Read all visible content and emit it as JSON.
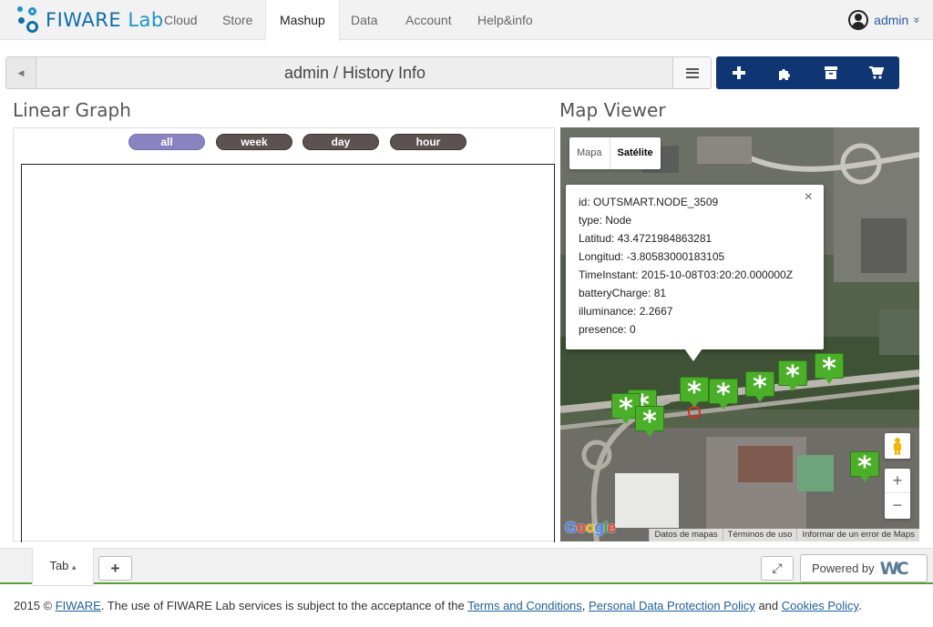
{
  "brand": {
    "name_a": "FIWARE",
    "name_b": "Lab"
  },
  "nav": {
    "items": [
      {
        "label": "Cloud"
      },
      {
        "label": "Store"
      },
      {
        "label": "Mashup"
      },
      {
        "label": "Data"
      },
      {
        "label": "Account"
      },
      {
        "label": "Help&info"
      }
    ],
    "active": "Mashup",
    "user": "admin",
    "user_caret": "»"
  },
  "workspace": {
    "title": "admin / History Info",
    "toolbar": [
      "add-icon",
      "puzzle-icon",
      "archive-icon",
      "cart-icon"
    ]
  },
  "linear_graph": {
    "title": "Linear Graph",
    "ranges": [
      {
        "label": "all",
        "active": true
      },
      {
        "label": "week",
        "active": false
      },
      {
        "label": "day",
        "active": false
      },
      {
        "label": "hour",
        "active": false
      }
    ]
  },
  "map_viewer": {
    "title": "Map Viewer",
    "map_types": [
      "Mapa",
      "Satélite"
    ],
    "selected_map_type": "Satélite",
    "info": [
      {
        "label": "id:",
        "value": "OUTSMART.NODE_3509"
      },
      {
        "label": "type:",
        "value": "Node"
      },
      {
        "label": "Latitud:",
        "value": "43.4721984863281"
      },
      {
        "label": "Longitud:",
        "value": "-3.80583000183105"
      },
      {
        "label": "TimeInstant:",
        "value": "2015-10-08T03:20:20.000000Z"
      },
      {
        "label": "batteryCharge:",
        "value": "81"
      },
      {
        "label": "illuminance:",
        "value": "2.2667"
      },
      {
        "label": "presence:",
        "value": "0"
      }
    ],
    "close_glyph": "×",
    "marker_glyph": "*",
    "zoom_in": "+",
    "zoom_out": "−",
    "google": "Google",
    "attribution": [
      "Datos de mapas",
      "Términos de uso",
      "Informar de un error de Maps"
    ]
  },
  "bottom": {
    "tab_label": "Tab",
    "tab_caret": "▴",
    "add_tab": "+",
    "fullscreen": "⤢",
    "powered_by": "Powered by",
    "powered_logo": "WC"
  },
  "footer": {
    "prefix": "2015 © ",
    "fiware": "FIWARE",
    "text1": ". The use of FIWARE Lab services is subject to the acceptance of the ",
    "terms": "Terms and Conditions",
    "sep1": ", ",
    "privacy": "Personal Data Protection Policy",
    "sep2": " and ",
    "cookies": "Cookies Policy",
    "end": "."
  },
  "colors": {
    "brand_blue": "#0e6ea8",
    "toolbar_blue": "#0f3572",
    "range_active": "#8a83c0",
    "range_inactive": "#5c5252",
    "marker_green": "#4caf2a",
    "footer_bar_green": "#5a9e3a"
  }
}
